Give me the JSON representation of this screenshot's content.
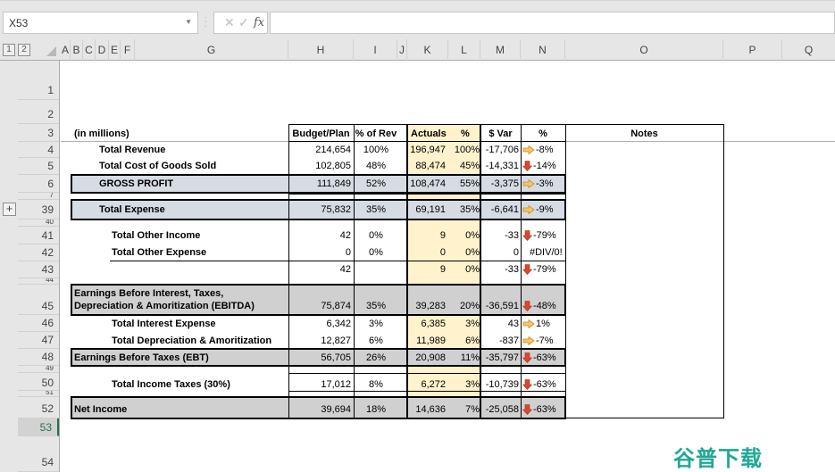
{
  "formula_bar": {
    "name_box": "X53",
    "cancel_icon": "✕",
    "enter_icon": "✓",
    "fx_label": "fx",
    "formula": ""
  },
  "outline_levels": [
    "1",
    "2"
  ],
  "expand_button": "+",
  "columns": [
    "A",
    "B",
    "C",
    "D",
    "E",
    "F",
    "G",
    "H",
    "I",
    "J",
    "K",
    "L",
    "M",
    "N",
    "O",
    "P",
    "Q"
  ],
  "rows": [
    "1",
    "2",
    "3",
    "4",
    "5",
    "6",
    "7",
    "39",
    "40",
    "41",
    "42",
    "43",
    "44",
    "45",
    "46",
    "47",
    "48",
    "49",
    "50",
    "51",
    "52",
    "53",
    "54"
  ],
  "selected_row": "53",
  "table": {
    "units_label": "(in millions)",
    "headers": {
      "budget": "Budget/Plan",
      "pct_rev": "% of Rev",
      "actuals": "Actuals",
      "actual_pct": "%",
      "var": "$ Var",
      "var_pct": "%",
      "notes": "Notes"
    },
    "lines": [
      {
        "row": "4",
        "label": "Total Revenue",
        "budget": "214,654",
        "pct_rev": "100%",
        "actuals": "196,947",
        "actual_pct": "100%",
        "var": "-17,706",
        "var_pct": "-8%",
        "icon": "arrow-right"
      },
      {
        "row": "5",
        "label": "Total Cost of Goods Sold",
        "budget": "102,805",
        "pct_rev": "48%",
        "actuals": "88,474",
        "actual_pct": "45%",
        "var": "-14,331",
        "var_pct": "-14%",
        "icon": "arrow-down"
      },
      {
        "row": "6",
        "label": "GROSS PROFIT",
        "budget": "111,849",
        "pct_rev": "52%",
        "actuals": "108,474",
        "actual_pct": "55%",
        "var": "-3,375",
        "var_pct": "-3%",
        "icon": "arrow-right"
      },
      {
        "row": "39",
        "label": "Total Expense",
        "budget": "75,832",
        "pct_rev": "35%",
        "actuals": "69,191",
        "actual_pct": "35%",
        "var": "-6,641",
        "var_pct": "-9%",
        "icon": "arrow-right"
      },
      {
        "row": "41",
        "label": "Total Other Income",
        "budget": "42",
        "pct_rev": "0%",
        "actuals": "9",
        "actual_pct": "0%",
        "var": "-33",
        "var_pct": "-79%",
        "icon": "arrow-down"
      },
      {
        "row": "42",
        "label": "Total Other Expense",
        "budget": "0",
        "pct_rev": "0%",
        "actuals": "0",
        "actual_pct": "0%",
        "var": "0",
        "var_pct": "#DIV/0!",
        "icon": ""
      },
      {
        "row": "43",
        "label": "",
        "budget": "42",
        "pct_rev": "",
        "actuals": "9",
        "actual_pct": "0%",
        "var": "-33",
        "var_pct": "-79%",
        "icon": "arrow-down"
      },
      {
        "row": "45",
        "label_line1": "Earnings Before Interest, Taxes,",
        "label_line2": "Depreciation & Amoritization (EBITDA)",
        "budget": "75,874",
        "pct_rev": "35%",
        "actuals": "39,283",
        "actual_pct": "20%",
        "var": "-36,591",
        "var_pct": "-48%",
        "icon": "arrow-down"
      },
      {
        "row": "46",
        "label": "Total Interest Expense",
        "budget": "6,342",
        "pct_rev": "3%",
        "actuals": "6,385",
        "actual_pct": "3%",
        "var": "43",
        "var_pct": "1%",
        "icon": "arrow-right"
      },
      {
        "row": "47",
        "label": "Total Depreciation & Amoritization",
        "budget": "12,827",
        "pct_rev": "6%",
        "actuals": "11,989",
        "actual_pct": "6%",
        "var": "-837",
        "var_pct": "-7%",
        "icon": "arrow-right"
      },
      {
        "row": "48",
        "label": "Earnings Before Taxes (EBT)",
        "budget": "56,705",
        "pct_rev": "26%",
        "actuals": "20,908",
        "actual_pct": "11%",
        "var": "-35,797",
        "var_pct": "-63%",
        "icon": "arrow-down"
      },
      {
        "row": "50",
        "label": "Total Income Taxes (30%)",
        "budget": "17,012",
        "pct_rev": "8%",
        "actuals": "6,272",
        "actual_pct": "3%",
        "var": "-10,739",
        "var_pct": "-63%",
        "icon": "arrow-down"
      },
      {
        "row": "52",
        "label": "Net Income",
        "budget": "39,694",
        "pct_rev": "18%",
        "actuals": "14,636",
        "actual_pct": "7%",
        "var": "-25,058",
        "var_pct": "-63%",
        "icon": "arrow-down"
      }
    ]
  },
  "colors": {
    "highlight_blue_gray": "#d6dce4",
    "highlight_gray": "#d0d0d0",
    "actuals_yellow": "#fff2cc",
    "arrow_orange": "#f0b44c",
    "arrow_red": "#d9482b",
    "selected_row_green": "#217346"
  },
  "watermark": "谷普下载"
}
